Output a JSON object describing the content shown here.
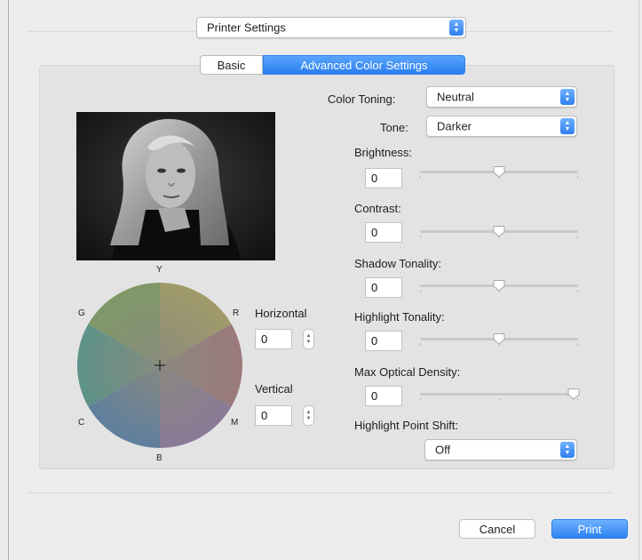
{
  "header": {
    "preset_menu": {
      "value": "Printer Settings",
      "icon": "popup-arrows-icon"
    }
  },
  "tabs": [
    {
      "label": "Basic",
      "selected": false
    },
    {
      "label": "Advanced Color Settings",
      "selected": true
    }
  ],
  "color": {
    "toning_label": "Color Toning:",
    "toning_value": "Neutral",
    "tone_label": "Tone:",
    "tone_value": "Darker"
  },
  "preview": {
    "icon": "photo-preview-black-and-white-portrait"
  },
  "color_wheel": {
    "labels": {
      "y": "Y",
      "r": "R",
      "g": "G",
      "c": "C",
      "m": "M",
      "b": "B"
    },
    "crosshair_icon": "crosshair-icon",
    "horizontal_label": "Horizontal",
    "horizontal_value": "0",
    "vertical_label": "Vertical",
    "vertical_value": "0"
  },
  "sliders": [
    {
      "key": "brightness",
      "label": "Brightness:",
      "value": "0",
      "position": 0.5
    },
    {
      "key": "contrast",
      "label": "Contrast:",
      "value": "0",
      "position": 0.5
    },
    {
      "key": "shadow",
      "label": "Shadow Tonality:",
      "value": "0",
      "position": 0.5
    },
    {
      "key": "highlight",
      "label": "Highlight Tonality:",
      "value": "0",
      "position": 0.5
    },
    {
      "key": "density",
      "label": "Max Optical Density:",
      "value": "0",
      "position": 1.0
    }
  ],
  "highlight_point_shift": {
    "label": "Highlight Point Shift:",
    "value": "Off"
  },
  "footer": {
    "cancel_label": "Cancel",
    "print_label": "Print"
  },
  "colors": {
    "accent": "#2f7ff0",
    "panel": "#e3e3e3",
    "window": "#ececec"
  }
}
